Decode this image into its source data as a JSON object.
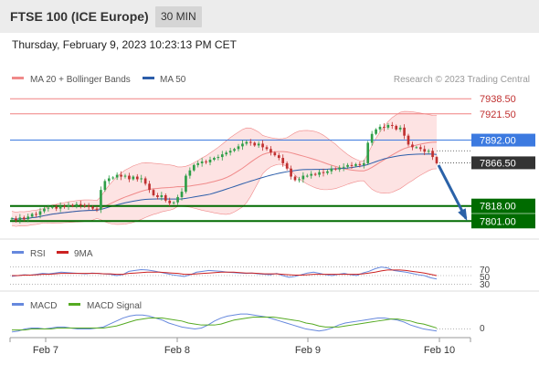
{
  "header": {
    "title": "FTSE 100 (ICE Europe)",
    "timeframe": "30 MIN",
    "datetime": "Thursday, February 9, 2023 10:23:13 PM CET"
  },
  "colors": {
    "bull": "#2e9e47",
    "bear": "#c03030",
    "bollinger": "#f08a8a",
    "bollinger_fill": "#fde3e3",
    "ma50": "#2c5eaa",
    "support": "#006b00",
    "resistance": "#f08080",
    "pivot": "#3c7ae0",
    "last": "#333333",
    "arrow": "#2b62a8",
    "rsi": "#6688dd",
    "rsi_ma": "#cc2222",
    "macd": "#6688dd",
    "macd_signal": "#55aa22"
  },
  "legend": {
    "ma20": "MA 20 + Bollinger Bands",
    "ma50": "MA 50",
    "credit": "Research © 2023 Trading Central",
    "rsi": "RSI",
    "rsi_ma": "9MA",
    "macd": "MACD",
    "macd_signal": "MACD Signal"
  },
  "price_axis": {
    "labels": [
      "7938.50",
      "7921.50",
      "7892.00",
      "7866.50",
      "7818.00",
      "7801.00"
    ]
  },
  "indicator_axis": {
    "rsi_levels": [
      "70",
      "50",
      "30"
    ],
    "macd_level": "0"
  },
  "chart_data": {
    "type": "candlestick",
    "x_ticks": [
      "Feb 7",
      "Feb 8",
      "Feb 9",
      "Feb 10"
    ],
    "ylim": [
      7790,
      7950
    ],
    "levels": [
      {
        "value": 7938.5,
        "kind": "resistance"
      },
      {
        "value": 7921.5,
        "kind": "resistance"
      },
      {
        "value": 7892.0,
        "kind": "pivot"
      },
      {
        "value": 7866.5,
        "kind": "last"
      },
      {
        "value": 7818.0,
        "kind": "support"
      },
      {
        "value": 7801.0,
        "kind": "support"
      }
    ],
    "close": [
      7804,
      7802,
      7805,
      7803,
      7806,
      7809,
      7808,
      7812,
      7815,
      7816,
      7817,
      7815,
      7818,
      7817,
      7819,
      7818,
      7820,
      7819,
      7818,
      7817,
      7815,
      7814,
      7836,
      7846,
      7849,
      7850,
      7853,
      7851,
      7852,
      7848,
      7851,
      7848,
      7849,
      7843,
      7836,
      7830,
      7828,
      7830,
      7824,
      7821,
      7822,
      7828,
      7834,
      7852,
      7858,
      7864,
      7866,
      7868,
      7867,
      7870,
      7872,
      7873,
      7876,
      7878,
      7880,
      7882,
      7885,
      7888,
      7890,
      7889,
      7886,
      7888,
      7884,
      7882,
      7878,
      7875,
      7872,
      7866,
      7860,
      7851,
      7847,
      7848,
      7852,
      7852,
      7854,
      7853,
      7856,
      7855,
      7857,
      7860,
      7859,
      7861,
      7862,
      7864,
      7863,
      7865,
      7864,
      7866,
      7889,
      7899,
      7904,
      7907,
      7906,
      7909,
      7908,
      7904,
      7906,
      7897,
      7887,
      7884,
      7884,
      7882,
      7879,
      7880,
      7873,
      7866
    ]
  },
  "rsi_data": {
    "rsi": [
      48,
      50,
      52,
      51,
      53,
      55,
      54,
      56,
      58,
      57,
      56,
      55,
      54,
      56,
      55,
      54,
      53,
      50,
      52,
      60,
      62,
      64,
      63,
      61,
      58,
      55,
      52,
      50,
      48,
      52,
      58,
      60,
      62,
      61,
      60,
      58,
      57,
      56,
      55,
      56,
      54,
      53,
      52,
      55,
      50,
      46,
      48,
      52,
      56,
      58,
      55,
      52,
      50,
      53,
      55,
      52,
      50,
      56,
      60,
      66,
      70,
      68,
      62,
      60,
      58,
      55,
      52,
      50,
      45,
      42
    ],
    "ma": [
      50,
      50,
      51,
      51,
      52,
      53,
      53,
      54,
      55,
      55,
      55,
      55,
      55,
      55,
      55,
      54,
      54,
      53,
      53,
      55,
      56,
      57,
      58,
      58,
      58,
      57,
      56,
      55,
      53,
      53,
      54,
      55,
      56,
      57,
      58,
      58,
      58,
      57,
      56,
      56,
      55,
      54,
      54,
      54,
      53,
      52,
      51,
      51,
      52,
      53,
      53,
      53,
      53,
      53,
      53,
      53,
      53,
      54,
      56,
      58,
      61,
      63,
      63,
      63,
      62,
      60,
      58,
      56,
      53,
      50
    ]
  },
  "macd_data": {
    "macd": [
      -3,
      -2,
      0,
      1,
      1,
      0,
      1,
      2,
      2,
      1,
      0,
      0,
      0,
      1,
      2,
      5,
      8,
      11,
      13,
      14,
      14,
      13,
      11,
      9,
      6,
      4,
      2,
      1,
      0,
      1,
      4,
      8,
      11,
      13,
      14,
      15,
      15,
      14,
      13,
      12,
      10,
      8,
      6,
      4,
      2,
      0,
      -1,
      -2,
      -1,
      1,
      4,
      6,
      7,
      8,
      9,
      10,
      11,
      11,
      10,
      9,
      7,
      4,
      2,
      0,
      -1,
      -2
    ],
    "signal": [
      -1,
      -1,
      -1,
      0,
      0,
      0,
      0,
      1,
      1,
      1,
      1,
      1,
      1,
      1,
      1,
      2,
      3,
      5,
      7,
      9,
      10,
      11,
      11,
      11,
      10,
      9,
      8,
      6,
      5,
      4,
      4,
      4,
      5,
      7,
      9,
      10,
      11,
      12,
      12,
      12,
      12,
      11,
      10,
      9,
      8,
      6,
      5,
      3,
      2,
      2,
      2,
      3,
      4,
      5,
      6,
      7,
      8,
      9,
      10,
      10,
      9,
      8,
      6,
      5,
      3,
      1
    ]
  }
}
